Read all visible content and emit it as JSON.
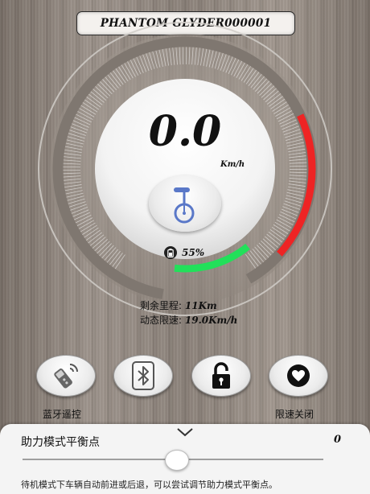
{
  "header": {
    "device_name": "PHANTOM GLYDER000001"
  },
  "speedometer": {
    "speed": "0.0",
    "unit": "Km/h",
    "mode_icon": "unicycle-icon",
    "speed_fraction": 0,
    "colors": {
      "green": "#22e05a",
      "red": "#ee2424"
    }
  },
  "battery": {
    "icon": "battery-icon",
    "percent_text": "55%",
    "level": 0.55
  },
  "stats": {
    "range_label": "剩余里程:",
    "range_value": "11Km",
    "limit_label": "动态限速:",
    "limit_value": "19.0Km/h"
  },
  "controls": [
    {
      "name": "bluetooth-remote-button",
      "icon": "remote-control-icon",
      "label": "蓝牙遥控"
    },
    {
      "name": "bluetooth-button",
      "icon": "bluetooth-icon",
      "label": ""
    },
    {
      "name": "lock-button",
      "icon": "unlock-icon",
      "label": ""
    },
    {
      "name": "speed-limit-button",
      "icon": "heart-icon",
      "label": "限速关闭"
    }
  ],
  "balance_panel": {
    "title": "助力模式平衡点",
    "value": "0",
    "slider_fraction": 0.51,
    "hint": "待机模式下车辆自动前进或后退，可以尝试调节助力模式平衡点。"
  }
}
